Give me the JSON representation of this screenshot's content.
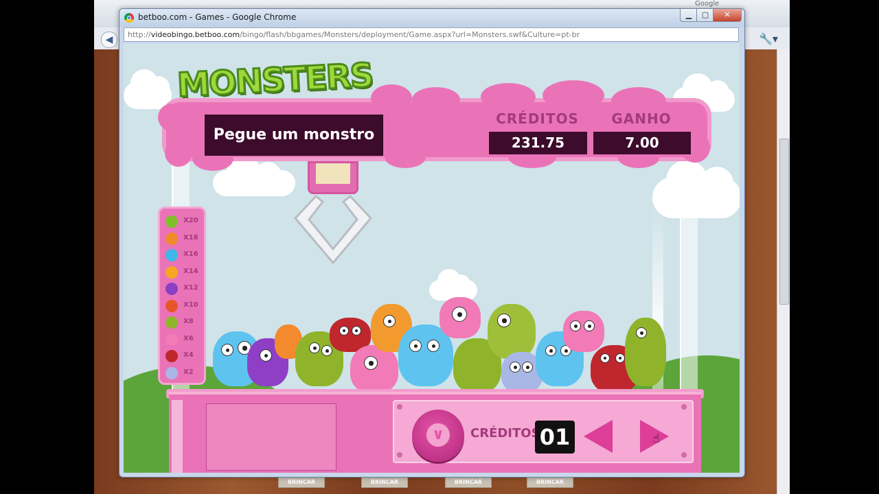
{
  "outer_browser": {
    "corner_text": "Google",
    "tab_label": "BRINCAR",
    "back_icon": "back-arrow-icon",
    "wrench_icon": "wrench-icon"
  },
  "window": {
    "title": "betboo.com - Games - Google Chrome",
    "url_prefix": "http://",
    "url_host": "videobingo.betboo.com",
    "url_path": "/bingo/flash/bbgames/Monsters/deployment/Game.aspx?url=Monsters.swf&Culture=pt-br",
    "min_glyph": "▁",
    "max_glyph": "▢",
    "close_glyph": "✕"
  },
  "game": {
    "logo": "MONSTERS",
    "prompt": "Pegue um monstro",
    "credits_label": "CRÉDITOS",
    "credits_value": "231.75",
    "win_label": "GANHO",
    "win_value": "7.00",
    "bet_label": "CRÉDITOS",
    "bet_value": "01",
    "ladder": [
      {
        "mult": "X20",
        "color": "#7fbf2a"
      },
      {
        "mult": "X18",
        "color": "#f08a2b"
      },
      {
        "mult": "X16",
        "color": "#3fb6e8"
      },
      {
        "mult": "X14",
        "color": "#f6a623"
      },
      {
        "mult": "X12",
        "color": "#8a3fc4"
      },
      {
        "mult": "X10",
        "color": "#e8552a"
      },
      {
        "mult": "X8",
        "color": "#8fb52a"
      },
      {
        "mult": "X6",
        "color": "#f27ab6"
      },
      {
        "mult": "X4",
        "color": "#c0262d"
      },
      {
        "mult": "X2",
        "color": "#a9b7e6"
      }
    ],
    "colors": {
      "banner_pink": "#ea73b8",
      "dark_panel": "#3d0b2c",
      "label_magenta": "#a33a7b",
      "logo_green": "#9fd83a"
    }
  }
}
